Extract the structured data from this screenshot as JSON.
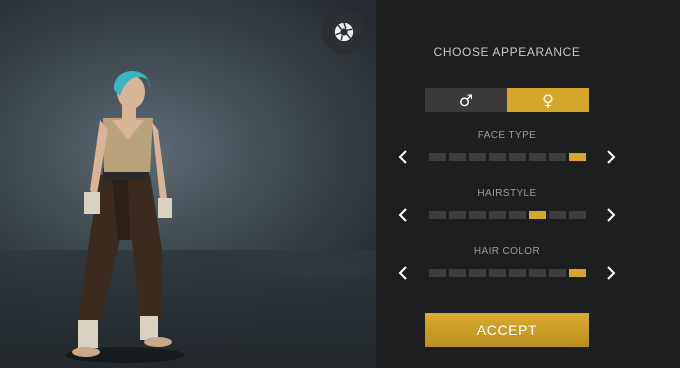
{
  "panel": {
    "title": "CHOOSE APPEARANCE",
    "gender": {
      "options": [
        {
          "symbol": "♂",
          "name": "male"
        },
        {
          "symbol": "♀",
          "name": "female"
        }
      ],
      "selected": "female"
    },
    "options": [
      {
        "label": "FACE TYPE",
        "segments": 8,
        "selected": 8
      },
      {
        "label": "HAIRSTYLE",
        "segments": 8,
        "selected": 6
      },
      {
        "label": "HAIR COLOR",
        "segments": 8,
        "selected": 8
      }
    ],
    "accept_label": "ACCEPT"
  },
  "icons": {
    "camera": "aperture-icon",
    "prev": "chevron-left-icon",
    "next": "chevron-right-icon"
  },
  "colors": {
    "accent": "#d4a82b",
    "top_bar": "#6fce7a"
  }
}
